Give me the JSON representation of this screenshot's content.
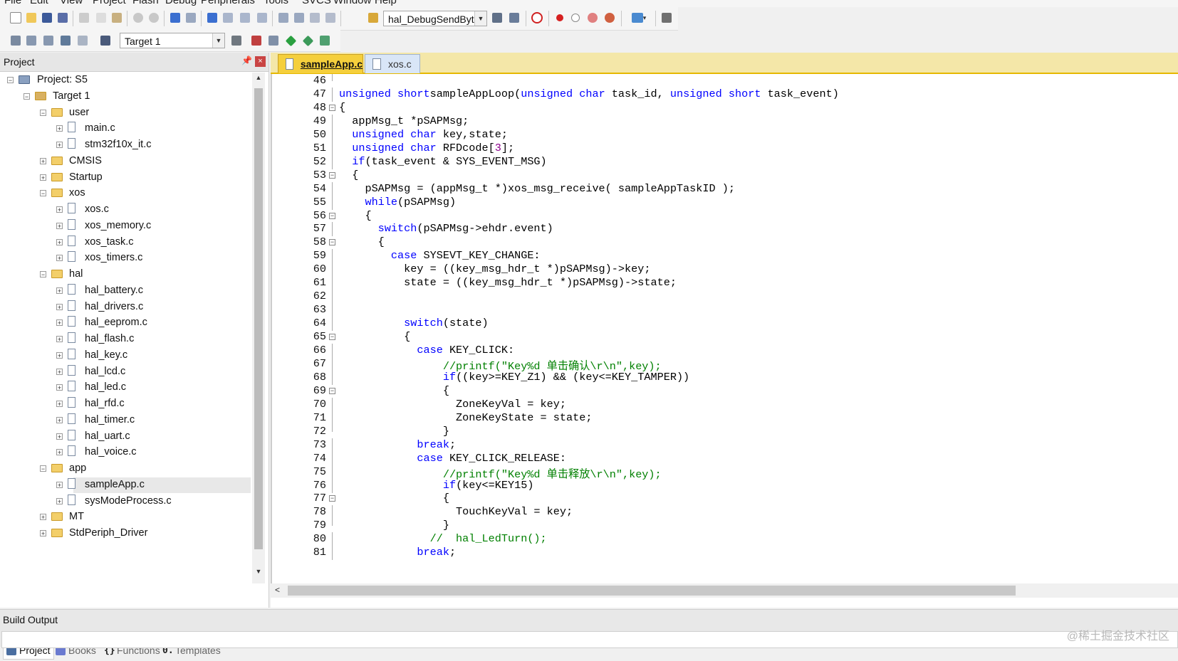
{
  "menu": [
    "File",
    "Edit",
    "View",
    "Project",
    "Flash",
    "Debug",
    "Peripherals",
    "Tools",
    "SVCS",
    "Window",
    "Help"
  ],
  "toolbar": {
    "function_combo": "hal_DebugSendByte",
    "target_combo": "Target 1"
  },
  "project_panel": {
    "title": "Project",
    "tree": [
      {
        "label": "Project: S5",
        "level": 0,
        "kind": "project",
        "expander": "−"
      },
      {
        "label": "Target 1",
        "level": 1,
        "kind": "target",
        "expander": "−"
      },
      {
        "label": "user",
        "level": 2,
        "kind": "folder",
        "expander": "−"
      },
      {
        "label": "main.c",
        "level": 3,
        "kind": "file",
        "expander": "+"
      },
      {
        "label": "stm32f10x_it.c",
        "level": 3,
        "kind": "file",
        "expander": "+"
      },
      {
        "label": "CMSIS",
        "level": 2,
        "kind": "folder",
        "expander": "+"
      },
      {
        "label": "Startup",
        "level": 2,
        "kind": "folder",
        "expander": "+"
      },
      {
        "label": "xos",
        "level": 2,
        "kind": "folder",
        "expander": "−"
      },
      {
        "label": "xos.c",
        "level": 3,
        "kind": "file",
        "expander": "+"
      },
      {
        "label": "xos_memory.c",
        "level": 3,
        "kind": "file",
        "expander": "+"
      },
      {
        "label": "xos_task.c",
        "level": 3,
        "kind": "file",
        "expander": "+"
      },
      {
        "label": "xos_timers.c",
        "level": 3,
        "kind": "file",
        "expander": "+"
      },
      {
        "label": "hal",
        "level": 2,
        "kind": "folder",
        "expander": "−"
      },
      {
        "label": "hal_battery.c",
        "level": 3,
        "kind": "file",
        "expander": "+"
      },
      {
        "label": "hal_drivers.c",
        "level": 3,
        "kind": "file",
        "expander": "+"
      },
      {
        "label": "hal_eeprom.c",
        "level": 3,
        "kind": "file",
        "expander": "+"
      },
      {
        "label": "hal_flash.c",
        "level": 3,
        "kind": "file",
        "expander": "+"
      },
      {
        "label": "hal_key.c",
        "level": 3,
        "kind": "file",
        "expander": "+"
      },
      {
        "label": "hal_lcd.c",
        "level": 3,
        "kind": "file",
        "expander": "+"
      },
      {
        "label": "hal_led.c",
        "level": 3,
        "kind": "file",
        "expander": "+"
      },
      {
        "label": "hal_rfd.c",
        "level": 3,
        "kind": "file",
        "expander": "+"
      },
      {
        "label": "hal_timer.c",
        "level": 3,
        "kind": "file",
        "expander": "+"
      },
      {
        "label": "hal_uart.c",
        "level": 3,
        "kind": "file",
        "expander": "+"
      },
      {
        "label": "hal_voice.c",
        "level": 3,
        "kind": "file",
        "expander": "+"
      },
      {
        "label": "app",
        "level": 2,
        "kind": "folder",
        "expander": "−"
      },
      {
        "label": "sampleApp.c",
        "level": 3,
        "kind": "file",
        "expander": "+",
        "selected": true
      },
      {
        "label": "sysModeProcess.c",
        "level": 3,
        "kind": "file",
        "expander": "+"
      },
      {
        "label": "MT",
        "level": 2,
        "kind": "folder",
        "expander": "+"
      },
      {
        "label": "StdPeriph_Driver",
        "level": 2,
        "kind": "folder",
        "expander": "+"
      }
    ],
    "bottom_tabs": [
      {
        "label": "Project",
        "icon": "project-tab-icon",
        "active": true
      },
      {
        "label": "Books",
        "icon": "books-icon",
        "active": false
      },
      {
        "label": "Functions",
        "icon": "functions-icon",
        "active": false
      },
      {
        "label": "Templates",
        "icon": "templates-icon",
        "active": false
      }
    ]
  },
  "editor": {
    "tabs": [
      {
        "label": "sampleApp.c",
        "active": true
      },
      {
        "label": "xos.c",
        "active": false
      }
    ],
    "lines": [
      {
        "n": "46",
        "fold": "end",
        "parts": []
      },
      {
        "n": "47",
        "fold": "",
        "parts": [
          [
            "kw",
            "unsigned short"
          ],
          [
            "",
            "sampleAppLoop("
          ],
          [
            "kw",
            "unsigned char"
          ],
          [
            "",
            " task_id, "
          ],
          [
            "kw",
            "unsigned short"
          ],
          [
            "",
            " task_event)"
          ]
        ]
      },
      {
        "n": "48",
        "fold": "open",
        "parts": [
          [
            "",
            "{"
          ]
        ]
      },
      {
        "n": "49",
        "fold": "",
        "parts": [
          [
            "",
            "  appMsg_t *pSAPMsg;"
          ]
        ]
      },
      {
        "n": "50",
        "fold": "",
        "parts": [
          [
            "kw",
            "  unsigned char"
          ],
          [
            "",
            " key,state;"
          ]
        ]
      },
      {
        "n": "51",
        "fold": "",
        "parts": [
          [
            "kw",
            "  unsigned char"
          ],
          [
            "",
            " RFDcode["
          ],
          [
            "num",
            "3"
          ],
          [
            "",
            "];"
          ]
        ]
      },
      {
        "n": "52",
        "fold": "",
        "parts": [
          [
            "kw",
            "  if"
          ],
          [
            "",
            "(task_event & SYS_EVENT_MSG)"
          ]
        ]
      },
      {
        "n": "53",
        "fold": "open",
        "parts": [
          [
            "",
            "  {"
          ]
        ]
      },
      {
        "n": "54",
        "fold": "",
        "parts": [
          [
            "",
            "    pSAPMsg = (appMsg_t *)xos_msg_receive( sampleAppTaskID );"
          ]
        ]
      },
      {
        "n": "55",
        "fold": "",
        "parts": [
          [
            "kw",
            "    while"
          ],
          [
            "",
            "(pSAPMsg)"
          ]
        ]
      },
      {
        "n": "56",
        "fold": "open",
        "parts": [
          [
            "",
            "    {"
          ]
        ]
      },
      {
        "n": "57",
        "fold": "",
        "parts": [
          [
            "kw",
            "      switch"
          ],
          [
            "",
            "(pSAPMsg->ehdr.event)"
          ]
        ]
      },
      {
        "n": "58",
        "fold": "open",
        "parts": [
          [
            "",
            "      {"
          ]
        ]
      },
      {
        "n": "59",
        "fold": "",
        "parts": [
          [
            "kw",
            "        case"
          ],
          [
            "",
            " SYSEVT_KEY_CHANGE:"
          ]
        ]
      },
      {
        "n": "60",
        "fold": "",
        "parts": [
          [
            "",
            "          key = ((key_msg_hdr_t *)pSAPMsg)->key;"
          ]
        ]
      },
      {
        "n": "61",
        "fold": "",
        "parts": [
          [
            "",
            "          state = ((key_msg_hdr_t *)pSAPMsg)->state;"
          ]
        ]
      },
      {
        "n": "62",
        "fold": "",
        "parts": []
      },
      {
        "n": "63",
        "fold": "",
        "parts": []
      },
      {
        "n": "64",
        "fold": "",
        "parts": [
          [
            "kw",
            "          switch"
          ],
          [
            "",
            "(state)"
          ]
        ]
      },
      {
        "n": "65",
        "fold": "open",
        "parts": [
          [
            "",
            "          {"
          ]
        ]
      },
      {
        "n": "66",
        "fold": "",
        "parts": [
          [
            "kw",
            "            case"
          ],
          [
            "",
            " KEY_CLICK:"
          ]
        ]
      },
      {
        "n": "67",
        "fold": "",
        "parts": [
          [
            "cm",
            "                //printf(\"Key%d 单击确认\\r\\n\",key);"
          ]
        ]
      },
      {
        "n": "68",
        "fold": "",
        "parts": [
          [
            "kw",
            "                if"
          ],
          [
            "",
            "((key>=KEY_Z1) && (key<=KEY_TAMPER))"
          ]
        ]
      },
      {
        "n": "69",
        "fold": "open",
        "parts": [
          [
            "",
            "                {"
          ]
        ]
      },
      {
        "n": "70",
        "fold": "",
        "parts": [
          [
            "",
            "                  ZoneKeyVal = key;"
          ]
        ]
      },
      {
        "n": "71",
        "fold": "",
        "parts": [
          [
            "",
            "                  ZoneKeyState = state;"
          ]
        ]
      },
      {
        "n": "72",
        "fold": "end",
        "parts": [
          [
            "",
            "                }"
          ]
        ]
      },
      {
        "n": "73",
        "fold": "",
        "parts": [
          [
            "kw",
            "            break"
          ],
          [
            "",
            ";"
          ]
        ]
      },
      {
        "n": "74",
        "fold": "",
        "parts": [
          [
            "kw",
            "            case"
          ],
          [
            "",
            " KEY_CLICK_RELEASE:"
          ]
        ]
      },
      {
        "n": "75",
        "fold": "",
        "parts": [
          [
            "cm",
            "                //printf(\"Key%d 单击释放\\r\\n\",key);"
          ]
        ]
      },
      {
        "n": "76",
        "fold": "",
        "parts": [
          [
            "kw",
            "                if"
          ],
          [
            "",
            "(key<=KEY15)"
          ]
        ]
      },
      {
        "n": "77",
        "fold": "open",
        "parts": [
          [
            "",
            "                {"
          ]
        ]
      },
      {
        "n": "78",
        "fold": "",
        "parts": [
          [
            "",
            "                  TouchKeyVal = key;"
          ]
        ]
      },
      {
        "n": "79",
        "fold": "end",
        "parts": [
          [
            "",
            "                }"
          ]
        ]
      },
      {
        "n": "80",
        "fold": "",
        "parts": [
          [
            "cm",
            "              //  hal_LedTurn();"
          ]
        ]
      },
      {
        "n": "81",
        "fold": "",
        "parts": [
          [
            "kw",
            "            break"
          ],
          [
            "",
            ";"
          ]
        ]
      }
    ]
  },
  "build_output": {
    "title": "Build Output"
  },
  "watermark": "@稀土掘金技术社区"
}
